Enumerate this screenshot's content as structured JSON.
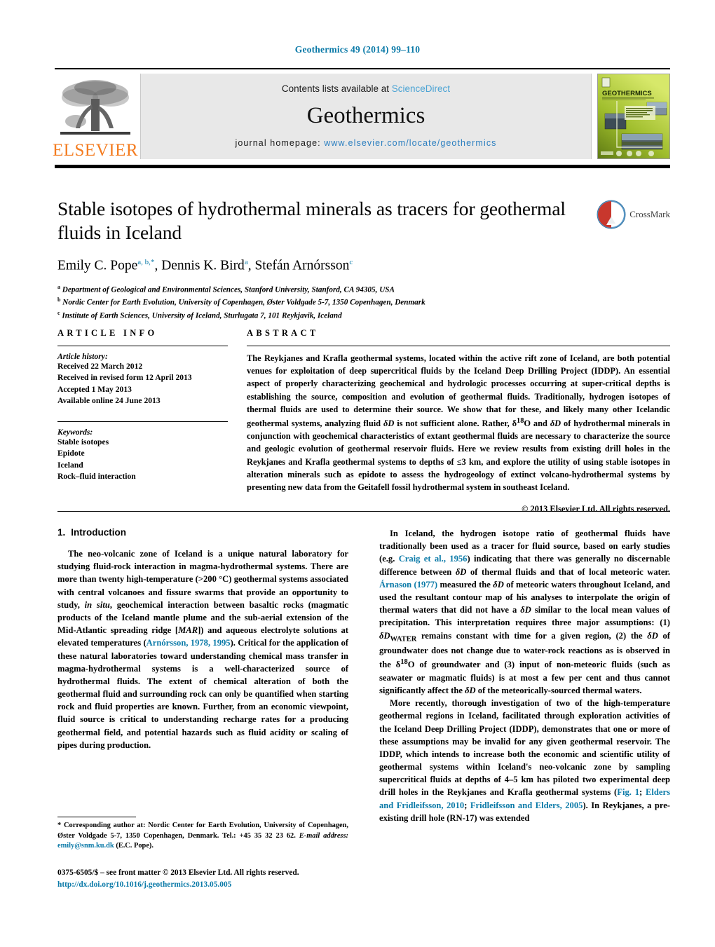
{
  "running_head": "Geothermics 49 (2014) 99–110",
  "masthead": {
    "contents_prefix": "Contents lists available at",
    "sciencedirect": "ScienceDirect",
    "journal_name": "Geothermics",
    "homepage_prefix": "journal homepage:",
    "homepage_url": "www.elsevier.com/locate/geothermics",
    "publisher_logo_text": "ELSEVIER",
    "cover_title": "GEOTHERMICS",
    "colors": {
      "link_blue": "#2c7fc0",
      "sciencedirect_blue": "#4aa3d4",
      "elsevier_orange": "#f47c20",
      "band_gray": "#e8e8e8",
      "running_head_blue": "#0b7aa8"
    }
  },
  "article": {
    "title": "Stable isotopes of hydrothermal minerals as tracers for geothermal fluids in Iceland",
    "crossmark_label": "CrossMark",
    "authors_html": "Emily C. Pope<sup>a,&nbsp;b,</sup><sup class=\"star\">*</sup>, Dennis K. Bird<sup>a</sup>, Stefán Arnórsson<sup>c</sup>",
    "affiliations": [
      {
        "marker": "a",
        "text": "Department of Geological and Environmental Sciences, Stanford University, Stanford, CA 94305, USA"
      },
      {
        "marker": "b",
        "text": "Nordic Center for Earth Evolution, University of Copenhagen, Øster Voldgade 5-7, 1350 Copenhagen, Denmark"
      },
      {
        "marker": "c",
        "text": "Institute of Earth Sciences, University of Iceland, Sturlugata 7, 101 Reykjavik, Iceland"
      }
    ]
  },
  "article_info": {
    "heading": "ARTICLE INFO",
    "history_label": "Article history:",
    "history": [
      "Received 22 March 2012",
      "Received in revised form 12 April 2013",
      "Accepted 1 May 2013",
      "Available online 24 June 2013"
    ],
    "keywords_label": "Keywords:",
    "keywords": [
      "Stable isotopes",
      "Epidote",
      "Iceland",
      "Rock–fluid interaction"
    ]
  },
  "abstract": {
    "heading": "ABSTRACT",
    "text": "The Reykjanes and Krafla geothermal systems, located within the active rift zone of Iceland, are both potential venues for exploitation of deep supercritical fluids by the Iceland Deep Drilling Project (IDDP). An essential aspect of properly characterizing geochemical and hydrologic processes occurring at super-critical depths is establishing the source, composition and evolution of geothermal fluids. Traditionally, hydrogen isotopes of thermal fluids are used to determine their source. We show that for these, and likely many other Icelandic geothermal systems, analyzing fluid δD is not sufficient alone. Rather, δ18O and δD of hydrothermal minerals in conjunction with geochemical characteristics of extant geothermal fluids are necessary to characterize the source and geologic evolution of geothermal reservoir fluids. Here we review results from existing drill holes in the Reykjanes and Krafla geothermal systems to depths of ≤3 km, and explore the utility of using stable isotopes in alteration minerals such as epidote to assess the hydrogeology of extinct volcano-hydrothermal systems by presenting new data from the Geitafell fossil hydrothermal system in southeast Iceland.",
    "copyright": "© 2013 Elsevier Ltd. All rights reserved."
  },
  "body": {
    "section_number": "1.",
    "section_title": "Introduction",
    "left_paragraphs": [
      "The neo-volcanic zone of Iceland is a unique natural laboratory for studying fluid-rock interaction in magma-hydrothermal systems. There are more than twenty high-temperature (>200 °C) geothermal systems associated with central volcanoes and fissure swarms that provide an opportunity to study, in situ, geochemical interaction between basaltic rocks (magmatic products of the Iceland mantle plume and the sub-aerial extension of the Mid-Atlantic spreading ridge [MAR]) and aqueous electrolyte solutions at elevated temperatures (Arnórsson, 1978, 1995). Critical for the application of these natural laboratories toward understanding chemical mass transfer in magma-hydrothermal systems is a well-characterized source of hydrothermal fluids. The extent of chemical alteration of both the geothermal fluid and surrounding rock can only be quantified when starting rock and fluid properties are known. Further, from an economic viewpoint, fluid source is critical to understanding recharge rates for a producing geothermal field, and potential hazards such as fluid acidity or scaling of pipes during production."
    ],
    "right_paragraphs": [
      "In Iceland, the hydrogen isotope ratio of geothermal fluids have traditionally been used as a tracer for fluid source, based on early studies (e.g. Craig et al., 1956) indicating that there was generally no discernable difference between δD of thermal fluids and that of local meteoric water. Árnason (1977) measured the δD of meteoric waters throughout Iceland, and used the resultant contour map of his analyses to interpolate the origin of thermal waters that did not have a δD similar to the local mean values of precipitation. This interpretation requires three major assumptions: (1) δDWATER remains constant with time for a given region, (2) the δD of groundwater does not change due to water-rock reactions as is observed in the δ18O of groundwater and (3) input of non-meteoric fluids (such as seawater or magmatic fluids) is at most a few per cent and thus cannot significantly affect the δD of the meteorically-sourced thermal waters.",
      "More recently, thorough investigation of two of the high-temperature geothermal regions in Iceland, facilitated through exploration activities of the Iceland Deep Drilling Project (IDDP), demonstrates that one or more of these assumptions may be invalid for any given geothermal reservoir. The IDDP, which intends to increase both the economic and scientific utility of geothermal systems within Iceland's neo-volcanic zone by sampling supercritical fluids at depths of 4–5 km has piloted two experimental deep drill holes in the Reykjanes and Krafla geothermal systems (Fig. 1; Elders and Fridleifsson, 2010; Fridleifsson and Elders, 2005). In Reykjanes, a pre-existing drill hole (RN-17) was extended"
    ],
    "inline_references": [
      "Arnórsson, 1978, 1995",
      "Craig et al., 1956",
      "Árnason (1977)",
      "Fig. 1",
      "Elders and Fridleifsson, 2010",
      "Fridleifsson and Elders, 2005"
    ]
  },
  "footnote": {
    "marker": "*",
    "corresponding": "Corresponding author at: Nordic Center for Earth Evolution, University of Copenhagen, Øster Voldgade 5-7, 1350 Copenhagen, Denmark. Tel.: +45 35 32 23 62.",
    "email_label": "E-mail address:",
    "email": "emily@snm.ku.dk",
    "email_suffix": "(E.C. Pope)."
  },
  "imprint": {
    "line1": "0375-6505/$ – see front matter © 2013 Elsevier Ltd. All rights reserved.",
    "doi": "http://dx.doi.org/10.1016/j.geothermics.2013.05.005"
  }
}
